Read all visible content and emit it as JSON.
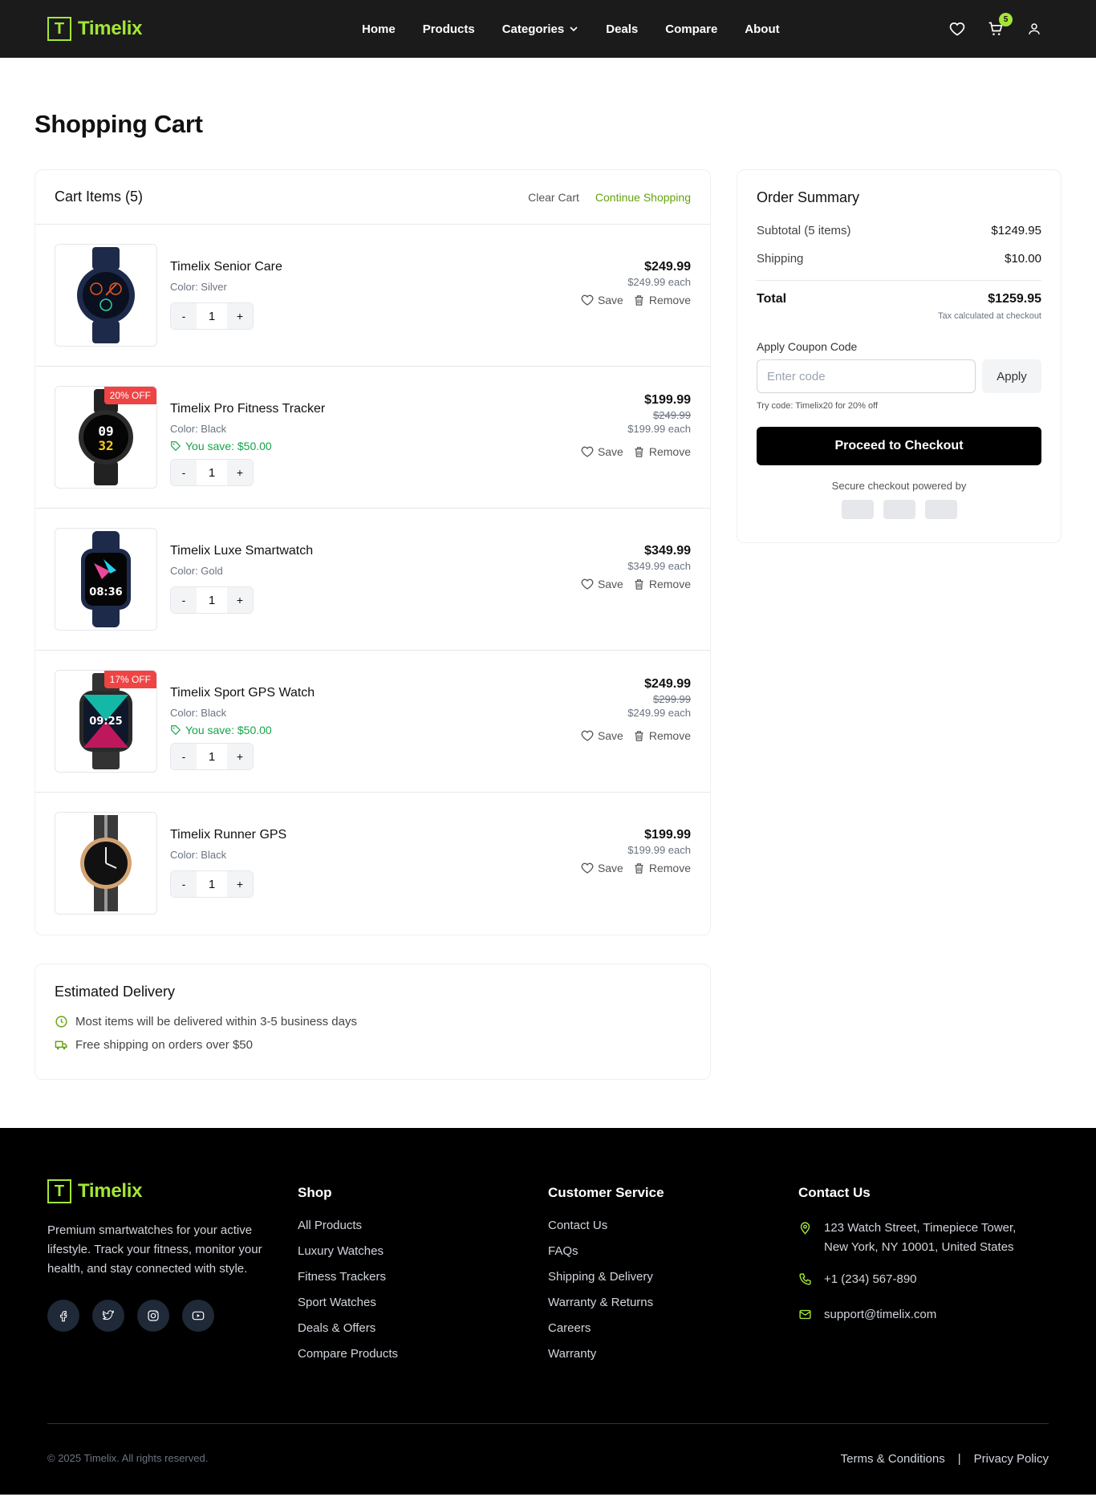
{
  "brand": {
    "logo_letter": "T",
    "name": "Timelix",
    "accent": "#a3e635"
  },
  "nav": {
    "items": [
      "Home",
      "Products",
      "Categories",
      "Deals",
      "Compare",
      "About"
    ]
  },
  "header": {
    "cart_count": "5"
  },
  "page": {
    "title": "Shopping Cart"
  },
  "cart": {
    "title": "Cart Items (5)",
    "clear_label": "Clear Cart",
    "continue_label": "Continue Shopping",
    "save_label": "Save",
    "remove_label": "Remove",
    "items": [
      {
        "name": "Timelix Senior Care",
        "color": "Color: Silver",
        "qty": "1",
        "price": "$249.99",
        "old_price": "",
        "each": "$249.99 each",
        "savings": "",
        "badge": ""
      },
      {
        "name": "Timelix Pro Fitness Tracker",
        "color": "Color: Black",
        "qty": "1",
        "price": "$199.99",
        "old_price": "$249.99",
        "each": "$199.99 each",
        "savings": "You save: $50.00",
        "badge": "20% OFF"
      },
      {
        "name": "Timelix Luxe Smartwatch",
        "color": "Color: Gold",
        "qty": "1",
        "price": "$349.99",
        "old_price": "",
        "each": "$349.99 each",
        "savings": "",
        "badge": ""
      },
      {
        "name": "Timelix Sport GPS Watch",
        "color": "Color: Black",
        "qty": "1",
        "price": "$249.99",
        "old_price": "$299.99",
        "each": "$249.99 each",
        "savings": "You save: $50.00",
        "badge": "17% OFF"
      },
      {
        "name": "Timelix Runner GPS",
        "color": "Color: Black",
        "qty": "1",
        "price": "$199.99",
        "old_price": "",
        "each": "$199.99 each",
        "savings": "",
        "badge": ""
      }
    ],
    "minus": "-",
    "plus": "+"
  },
  "delivery": {
    "title": "Estimated Delivery",
    "line1": "Most items will be delivered within 3-5 business days",
    "line2": "Free shipping on orders over $50"
  },
  "summary": {
    "title": "Order Summary",
    "subtotal_label": "Subtotal (5 items)",
    "subtotal_value": "$1249.95",
    "shipping_label": "Shipping",
    "shipping_value": "$10.00",
    "total_label": "Total",
    "total_value": "$1259.95",
    "tax_note": "Tax calculated at checkout",
    "coupon_label": "Apply Coupon Code",
    "coupon_placeholder": "Enter code",
    "apply_label": "Apply",
    "try_code": "Try code: Timelix20 for 20% off",
    "checkout_label": "Proceed to Checkout",
    "secure_text": "Secure checkout powered by"
  },
  "footer": {
    "about": "Premium smartwatches for your active lifestyle. Track your fitness, monitor your health, and stay connected with style.",
    "shop_title": "Shop",
    "shop_links": [
      "All Products",
      "Luxury Watches",
      "Fitness Trackers",
      "Sport Watches",
      "Deals & Offers",
      "Compare Products"
    ],
    "service_title": "Customer Service",
    "service_links": [
      "Contact Us",
      "FAQs",
      "Shipping & Delivery",
      "Warranty & Returns",
      "Careers",
      "Warranty"
    ],
    "contact_title": "Contact Us",
    "address": "123 Watch Street, Timepiece Tower, New York, NY 10001, United States",
    "phone": "+1 (234) 567-890",
    "email": "support@timelix.com",
    "copyright": "© 2025 Timelix. All rights reserved.",
    "terms": "Terms & Conditions",
    "separator": "|",
    "privacy": "Privacy Policy"
  }
}
